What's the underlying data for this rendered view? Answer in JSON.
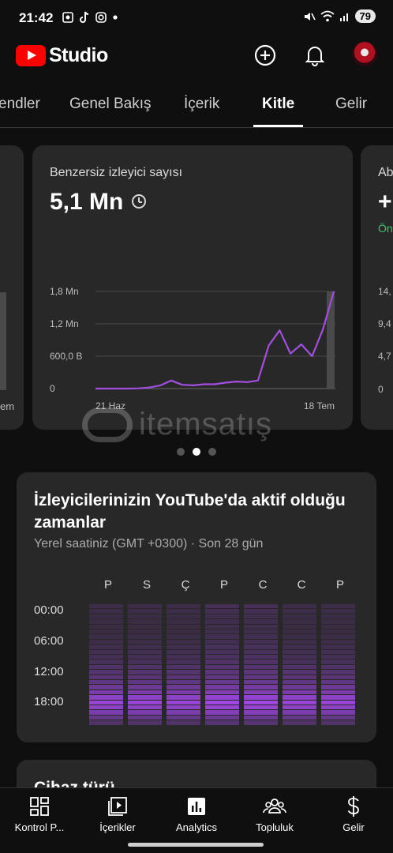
{
  "status_bar": {
    "time": "21:42",
    "battery": "79"
  },
  "header": {
    "app_name": "Studio"
  },
  "tabs": [
    {
      "label": "endler"
    },
    {
      "label": "Genel Bakış"
    },
    {
      "label": "İçerik"
    },
    {
      "label": "Kitle"
    },
    {
      "label": "Gelir"
    }
  ],
  "left_card": {
    "tick_label": "em"
  },
  "main_card": {
    "title": "Benzersiz izleyici sayısı",
    "value": "5,1 Mn",
    "chart_data": {
      "type": "line",
      "title": "Benzersiz izleyici sayısı",
      "y_ticks": [
        "1,8 Mn",
        "1,2 Mn",
        "600,0 B",
        "0"
      ],
      "x_ticks": [
        "21 Haz",
        "18 Tem"
      ],
      "ylim": [
        0,
        1800000
      ],
      "series": [
        {
          "color": "#a24fe0",
          "values": [
            0,
            0,
            0,
            0,
            5000,
            20000,
            60000,
            150000,
            70000,
            60000,
            80000,
            80000,
            110000,
            130000,
            120000,
            150000,
            800000,
            1080000,
            650000,
            820000,
            600000,
            1100000,
            1800000
          ]
        }
      ]
    }
  },
  "right_card": {
    "title_partial": "Ab",
    "value_partial": "+",
    "sub_partial": "Ön",
    "y_ticks": [
      "14,",
      "9,4",
      "4,7",
      "0"
    ]
  },
  "watermark": {
    "text": "itemsatış"
  },
  "heatmap_card": {
    "title": "İzleyicilerinizin YouTube'da aktif olduğu zamanlar",
    "subtitle": "Yerel saatiniz (GMT +0300) · Son 28 gün",
    "days": [
      "P",
      "S",
      "Ç",
      "P",
      "C",
      "C",
      "P"
    ],
    "time_labels": [
      "00:00",
      "06:00",
      "12:00",
      "18:00"
    ]
  },
  "next_card": {
    "title_partial": "Cihaz türü"
  },
  "bottom_nav": [
    {
      "label": "Kontrol P...",
      "icon": "dashboard-icon"
    },
    {
      "label": "İçerikler",
      "icon": "content-icon"
    },
    {
      "label": "Analytics",
      "icon": "analytics-icon"
    },
    {
      "label": "Topluluk",
      "icon": "community-icon"
    },
    {
      "label": "Gelir",
      "icon": "dollar-icon"
    }
  ],
  "colors": {
    "accent": "#a24fe0",
    "card": "#282828",
    "background": "#0f0f0f",
    "brand_red": "#ff0000"
  }
}
